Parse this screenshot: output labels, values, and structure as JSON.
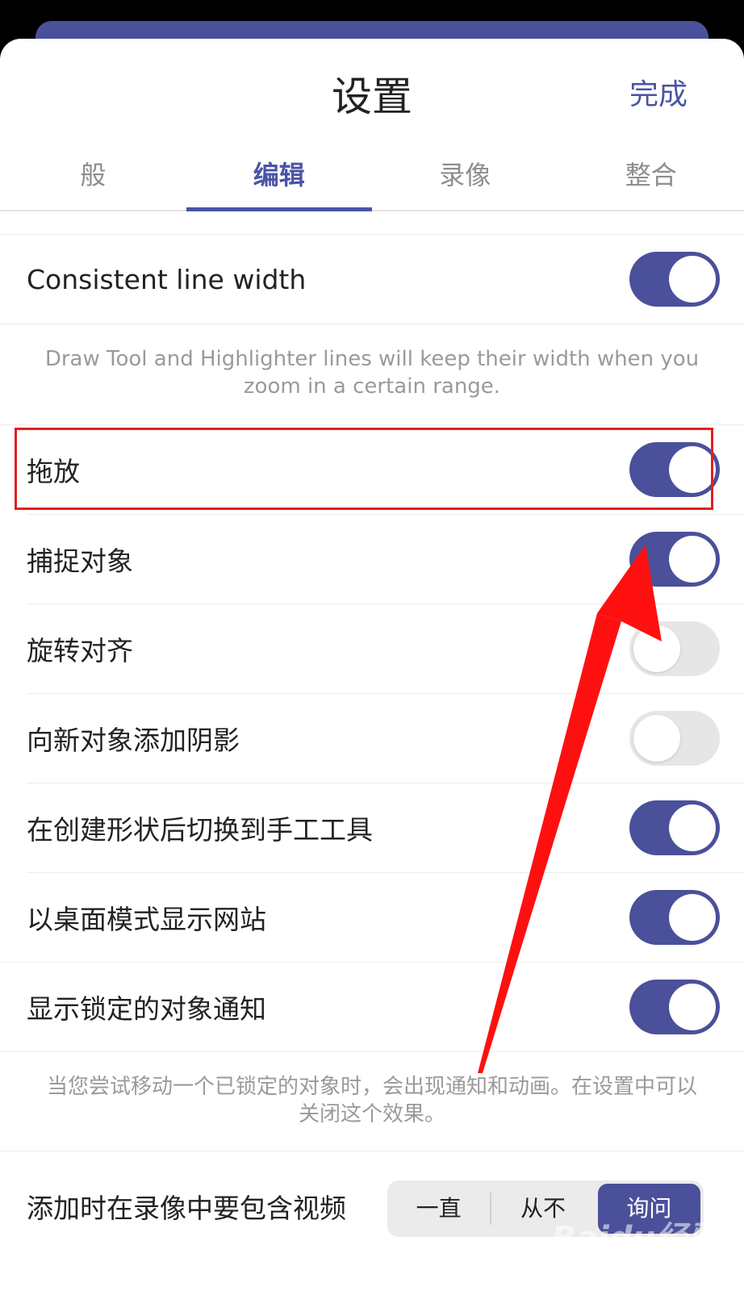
{
  "header": {
    "title": "设置",
    "done_label": "完成"
  },
  "tabs": [
    {
      "label": "般",
      "active": false
    },
    {
      "label": "编辑",
      "active": true
    },
    {
      "label": "录像",
      "active": false
    },
    {
      "label": "整合",
      "active": false
    }
  ],
  "settings": {
    "consistent_line_width": {
      "label": "Consistent line width",
      "on": true
    },
    "consistent_line_width_note": "Draw Tool and Highlighter lines will keep their width when you zoom in a certain range.",
    "drag_drop": {
      "label": "拖放",
      "on": true
    },
    "snap_objects": {
      "label": "捕捉对象",
      "on": true
    },
    "rotate_align": {
      "label": "旋转对齐",
      "on": false
    },
    "add_shadow": {
      "label": "向新对象添加阴影",
      "on": false
    },
    "switch_hand_tool": {
      "label": "在创建形状后切换到手工工具",
      "on": true
    },
    "desktop_mode": {
      "label": "以桌面模式显示网站",
      "on": true
    },
    "locked_notice": {
      "label": "显示锁定的对象通知",
      "on": true
    },
    "locked_notice_note": "当您尝试移动一个已锁定的对象时，会出现通知和动画。在设置中可以关闭这个效果。",
    "include_video": {
      "label": "添加时在录像中要包含视频",
      "options": [
        "一直",
        "从不",
        "询问"
      ],
      "selected": "询问"
    }
  },
  "watermark": "Baidu经验",
  "colors": {
    "accent": "#4a5099",
    "annotation": "#e02020"
  }
}
